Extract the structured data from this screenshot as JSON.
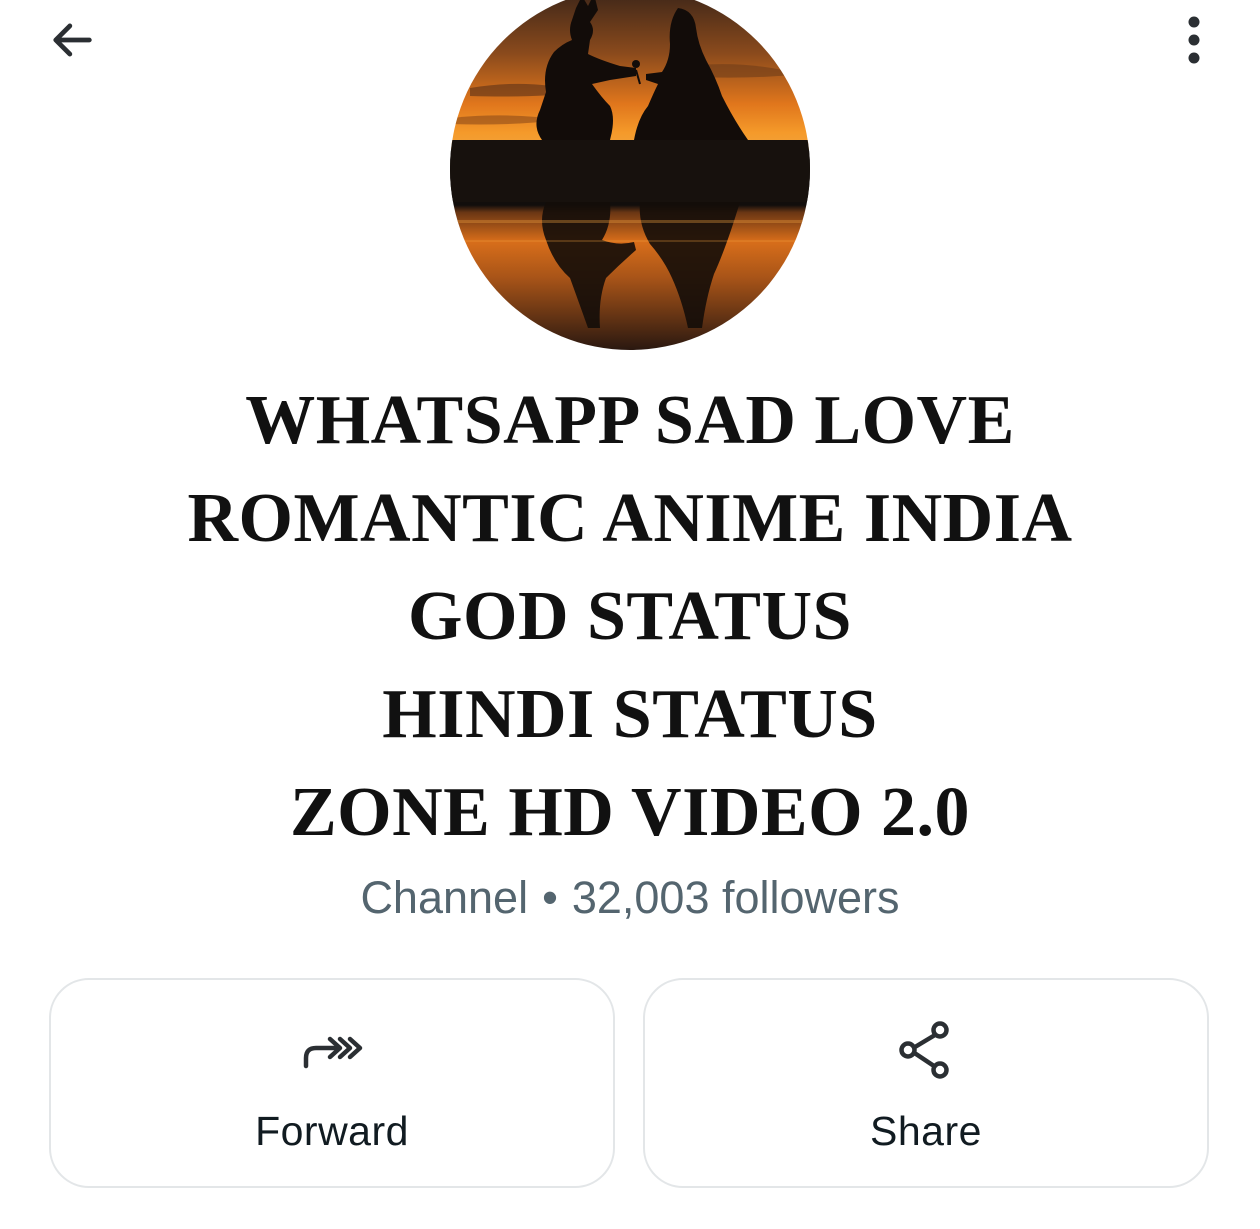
{
  "header": {
    "back_icon": "arrow-left-icon",
    "menu_icon": "more-vertical-icon"
  },
  "channel": {
    "title_lines": [
      "WHATSAPP SAD LOVE",
      "ROMANTIC ANIME INDIA",
      "GOD STATUS",
      "HINDI STATUS",
      "ZONE HD VIDEO 2.0"
    ],
    "type_label": "Channel",
    "separator": "•",
    "followers_label": "32,003 followers"
  },
  "actions": {
    "forward": {
      "label": "Forward",
      "icon": "forward-icon"
    },
    "share": {
      "label": "Share",
      "icon": "share-icon"
    }
  },
  "colors": {
    "title": "#111111",
    "subtitle": "#54656f",
    "icon": "#2b2f33",
    "card_border": "#e3e6e8"
  }
}
